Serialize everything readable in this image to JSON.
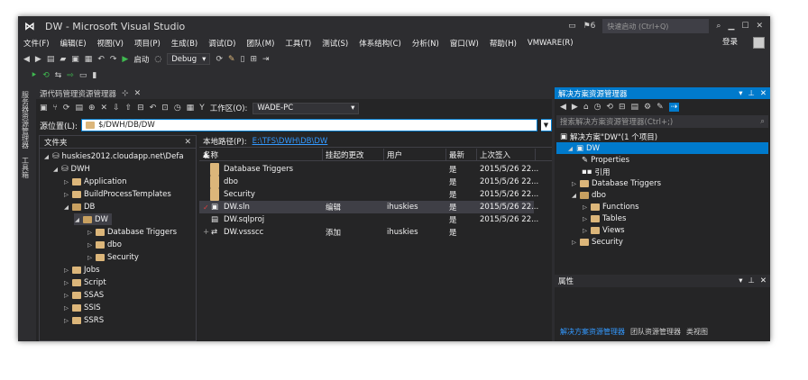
{
  "window": {
    "title": "DW - Microsoft Visual Studio"
  },
  "titlebar": {
    "notify_count": "6",
    "quick_launch_placeholder": "快速启动 (Ctrl+Q)"
  },
  "menu": [
    "文件(F)",
    "编辑(E)",
    "视图(V)",
    "项目(P)",
    "生成(B)",
    "调试(D)",
    "团队(M)",
    "工具(T)",
    "测试(S)",
    "体系结构(C)",
    "分析(N)",
    "窗口(W)",
    "帮助(H)",
    "VMWARE(R)"
  ],
  "login_label": "登录",
  "toolbar": {
    "start_label": "启动",
    "config_value": "Debug"
  },
  "left_side_tabs": [
    "服务器资源管理器",
    "工具箱"
  ],
  "sce": {
    "tab_title": "源代码管理资源管理器",
    "workspace_label": "工作区(O):",
    "workspace_value": "WADE-PC",
    "source_label": "源位置(L):",
    "source_value": "$/DWH/DB/DW",
    "folders_title": "文件夹",
    "local_path_label": "本地路径(P):",
    "local_path_value": "E:\\TFS\\DWH\\DB\\DW",
    "columns": [
      "名称",
      "挂起的更改",
      "用户",
      "最新",
      "上次签入"
    ],
    "files": [
      {
        "name": "Database Triggers",
        "change": "",
        "user": "",
        "latest": "是",
        "checkin": "2015/5/26 22..."
      },
      {
        "name": "dbo",
        "change": "",
        "user": "",
        "latest": "是",
        "checkin": "2015/5/26 22..."
      },
      {
        "name": "Security",
        "change": "",
        "user": "",
        "latest": "是",
        "checkin": "2015/5/26 22..."
      },
      {
        "name": "DW.sln",
        "change": "编辑",
        "user": "ihuskies",
        "latest": "是",
        "checkin": "2015/5/26 22..."
      },
      {
        "name": "DW.sqlproj",
        "change": "",
        "user": "",
        "latest": "是",
        "checkin": "2015/5/26 22..."
      },
      {
        "name": "DW.vssscc",
        "change": "添加",
        "user": "ihuskies",
        "latest": "是",
        "checkin": ""
      }
    ],
    "tree": [
      {
        "label": "huskies2012.cloudapp.net\\Defa",
        "arrow": "◢"
      },
      {
        "label": "DWH",
        "arrow": "◢"
      },
      {
        "label": "Application",
        "arrow": "▷"
      },
      {
        "label": "BuildProcessTemplates",
        "arrow": "▷"
      },
      {
        "label": "DB",
        "arrow": "◢"
      },
      {
        "label": "DW",
        "arrow": "◢"
      },
      {
        "label": "Database Triggers",
        "arrow": "▷"
      },
      {
        "label": "dbo",
        "arrow": "▷"
      },
      {
        "label": "Security",
        "arrow": "▷"
      },
      {
        "label": "Jobs",
        "arrow": "▷"
      },
      {
        "label": "Script",
        "arrow": "▷"
      },
      {
        "label": "SSAS",
        "arrow": "▷"
      },
      {
        "label": "SSIS",
        "arrow": "▷"
      },
      {
        "label": "SSRS",
        "arrow": "▷"
      }
    ]
  },
  "sol": {
    "title": "解决方案资源管理器",
    "search_placeholder": "搜索解决方案资源管理器(Ctrl+;)",
    "tree": [
      {
        "label": "解决方案\"DW\"(1 个项目)",
        "arrow": ""
      },
      {
        "label": "DW",
        "arrow": "◢"
      },
      {
        "label": "Properties",
        "arrow": ""
      },
      {
        "label": "引用",
        "arrow": ""
      },
      {
        "label": "Database Triggers",
        "arrow": "▷"
      },
      {
        "label": "dbo",
        "arrow": "◢"
      },
      {
        "label": "Functions",
        "arrow": "▷"
      },
      {
        "label": "Tables",
        "arrow": "▷"
      },
      {
        "label": "Views",
        "arrow": "▷"
      },
      {
        "label": "Security",
        "arrow": "▷"
      }
    ],
    "tabs": [
      "解决方案资源管理器",
      "团队资源管理器",
      "类视图"
    ]
  },
  "props": {
    "title": "属性"
  },
  "colors": {
    "accent": "#007acc",
    "bg": "#2d2d30",
    "panel": "#252526"
  }
}
